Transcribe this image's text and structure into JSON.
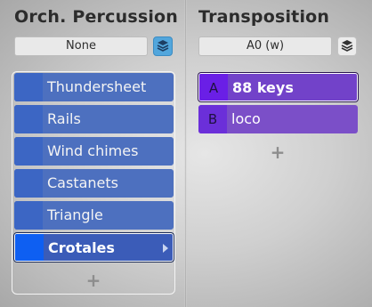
{
  "left_panel": {
    "title": "Orch. Percussion",
    "select_value": "None",
    "layers_icon": "layers-icon",
    "add_label": "+",
    "instruments": [
      {
        "label": "Thundersheet"
      },
      {
        "label": "Rails"
      },
      {
        "label": "Wind chimes"
      },
      {
        "label": "Castanets"
      },
      {
        "label": "Triangle"
      },
      {
        "label": "Crotales",
        "selected": true
      }
    ]
  },
  "right_panel": {
    "title": "Transposition",
    "select_value": "A0 (w)",
    "layers_icon": "layers-icon",
    "add_label": "+",
    "articulations": [
      {
        "letter": "A",
        "label": "88 keys",
        "selected": true
      },
      {
        "letter": "B",
        "label": "loco"
      }
    ]
  },
  "colors": {
    "instrument_row": "#4d70bf",
    "instrument_selected_swatch": "#0e5ff2",
    "transposition_row": "#7b4fc8",
    "layers_button_active": "#52a6dc"
  }
}
